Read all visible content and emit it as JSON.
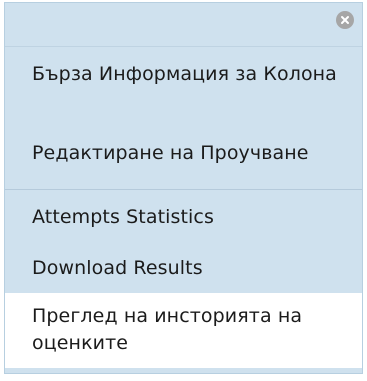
{
  "menu": {
    "close_icon": "close-icon",
    "items": [
      {
        "label": "Бърза Информация за Колона"
      },
      {
        "label": "Редактиране на Проучване"
      },
      {
        "label": "Attempts Statistics"
      },
      {
        "label": "Download Results"
      },
      {
        "label": "Преглед на инсторията на оценките"
      }
    ]
  },
  "colors": {
    "menu_background": "#cfe1ee",
    "highlight_background": "#ffffff",
    "text": "#1b1b1b",
    "close_button": "#a6a6a6"
  }
}
